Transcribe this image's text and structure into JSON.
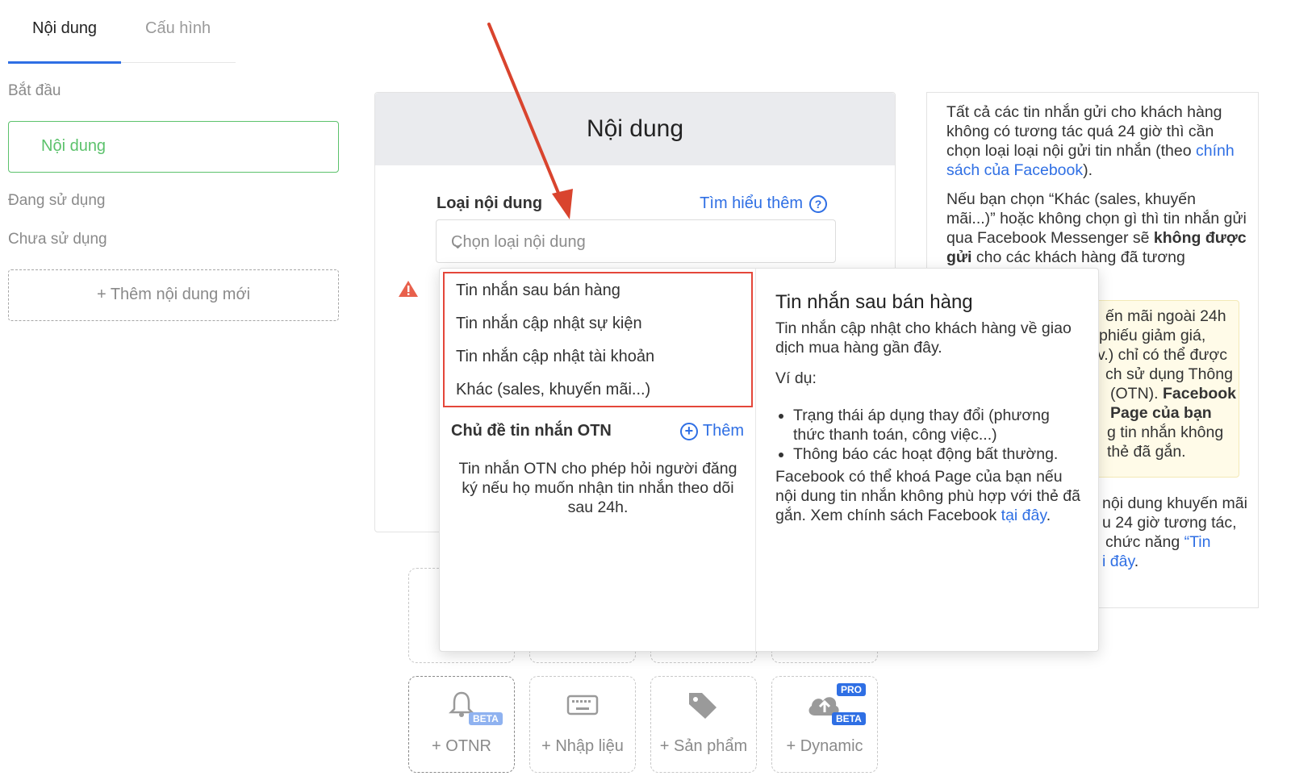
{
  "tabs": [
    {
      "label": "Nội dung",
      "active": true
    },
    {
      "label": "Cấu hình",
      "active": false
    }
  ],
  "sidebar": {
    "start_label": "Bắt đầu",
    "start_item": "Nội dung",
    "in_use_label": "Đang sử dụng",
    "unused_label": "Chưa sử dụng",
    "add_new": "+ Thêm nội dung mới"
  },
  "main": {
    "title": "Nội dung",
    "field_label": "Loại nội dung",
    "learn_more": "Tìm hiểu thêm",
    "select_placeholder": "Chọn loại nội dung"
  },
  "popup": {
    "options": [
      "Tin nhắn sau bán hàng",
      "Tin nhắn cập nhật sự kiện",
      "Tin nhắn cập nhật tài khoản",
      "Khác (sales, khuyến mãi...)"
    ],
    "otn_title": "Chủ đề tin nhắn OTN",
    "otn_add": "Thêm",
    "otn_desc": "Tin nhắn OTN cho phép hỏi người đăng ký nếu họ muốn nhận tin nhắn theo dõi sau 24h.",
    "detail_title": "Tin nhắn sau bán hàng",
    "detail_desc": "Tin nhắn cập nhật cho khách hàng về giao dịch mua hàng gần đây.",
    "example_label": "Ví dụ:",
    "examples": [
      "Trạng thái áp dụng thay đổi (phương thức thanh toán, công việc...)",
      "Thông báo các hoạt động bất thường."
    ],
    "warning_text": "Facebook có thể khoá Page của bạn nếu nội dung tin nhắn không phù hợp với thẻ đã gắn. Xem chính sách Facebook ",
    "warning_link": "tại đây",
    "warning_end": "."
  },
  "info": {
    "p1_text": "Tất cả các tin nhắn gửi cho khách hàng không có tương tác quá 24 giờ thì cần chọn loại loại nội gửi tin nhắn (theo ",
    "p1_link": "chính sách của Facebook",
    "p1_end": ").",
    "p2_text": "Nếu bạn chọn “Khác (sales, khuyến mãi...)” hoặc không chọn gì thì tin nhắn gửi qua Facebook Messenger sẽ ",
    "p2_bold": "không được gửi",
    "p2_end": " cho các khách hàng đã tương",
    "yellow_lines": [
      "ến mãi ngoài 24h",
      "phiếu giảm giá,",
      "v.) chỉ có thể được",
      "ch sử dụng Thông",
      "(OTN).",
      "Page của bạn",
      "g tin nhắn không",
      "thẻ đã gắn."
    ],
    "yellow_bold": "Facebook",
    "p3_lines": [
      "nội dung khuyến mãi",
      "u 24 giờ tương tác,",
      "chức năng "
    ],
    "p3_link1": "“Tin",
    "p3_link2": "i đây",
    "p3_end": "."
  },
  "tiles": [
    {
      "label": "+ OTNR",
      "icon": "bell-icon",
      "badges": [
        "BETA"
      ]
    },
    {
      "label": "+ Nhập liệu",
      "icon": "keyboard-icon",
      "badges": []
    },
    {
      "label": "+ Sản phẩm",
      "icon": "tags-icon",
      "badges": []
    },
    {
      "label": "+ Dynamic",
      "icon": "cloud-upload-icon",
      "badges": [
        "PRO",
        "BETA"
      ]
    }
  ],
  "colors": {
    "accent": "#2f6fe4",
    "green": "#5cc26c",
    "highlight_red": "#e4473a",
    "annotation_arrow": "#d9442e"
  }
}
